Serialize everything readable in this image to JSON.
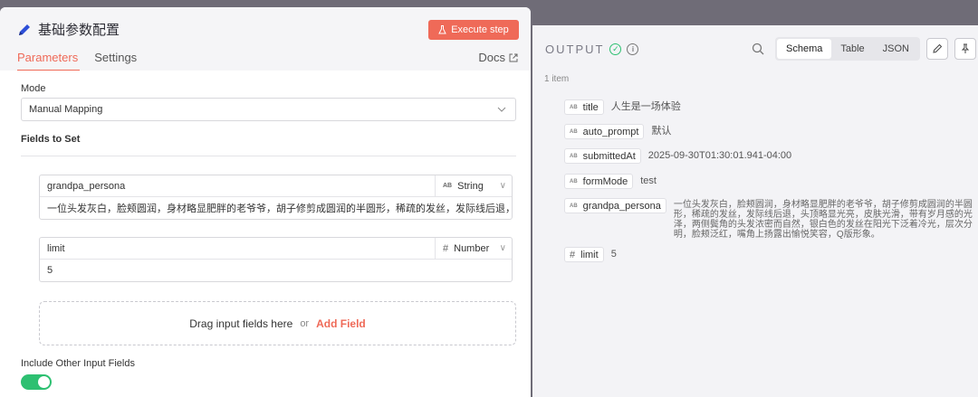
{
  "node": {
    "title": "基础参数配置",
    "execute_label": "Execute step",
    "tabs": [
      {
        "label": "Parameters",
        "active": true
      },
      {
        "label": "Settings",
        "active": false
      }
    ],
    "docs_label": "Docs"
  },
  "form": {
    "mode_label": "Mode",
    "mode_value": "Manual Mapping",
    "fields_label": "Fields to Set",
    "fields": [
      {
        "name": "grandpa_persona",
        "type": "String",
        "type_icon": "AB",
        "value": "一位头发灰白，脸颊圆润，身材略显肥胖的老爷爷，胡子修剪成圆润的半圆形，稀疏的发丝，发际线后退，头顶略显光亮"
      },
      {
        "name": "limit",
        "type": "Number",
        "type_icon": "#",
        "value": "5"
      }
    ],
    "drop_text": "Drag input fields here",
    "drop_or": "or",
    "add_field_label": "Add Field",
    "include_other_label": "Include Other Input Fields",
    "include_other_on": true
  },
  "output": {
    "title": "OUTPUT",
    "view_options": [
      "Schema",
      "Table",
      "JSON"
    ],
    "active_view": "Schema",
    "item_count": "1 item",
    "props": [
      {
        "icon": "AB",
        "key": "title",
        "value": "人生是一场体验"
      },
      {
        "icon": "AB",
        "key": "auto_prompt",
        "value": "默认"
      },
      {
        "icon": "AB",
        "key": "submittedAt",
        "value": "2025-09-30T01:30:01.941-04:00"
      },
      {
        "icon": "AB",
        "key": "formMode",
        "value": "test"
      },
      {
        "icon": "AB",
        "key": "grandpa_persona",
        "value": "一位头发灰白，脸颊圆润，身材略显肥胖的老爷爷，胡子修剪成圆润的半圆形，稀疏的发丝，发际线后退，头顶略显光亮，皮肤光滑，带有岁月感的光泽，两侧鬓角的头发浓密而自然，银白色的发丝在阳光下泛着冷光，层次分明，脸颊泛红，嘴角上扬露出愉悦笑容，Q版形象。"
      },
      {
        "icon": "#",
        "key": "limit",
        "value": "5"
      }
    ]
  },
  "colors": {
    "accent": "#ef6a58",
    "success": "#2dc071",
    "backdrop": "#6f6c77"
  }
}
